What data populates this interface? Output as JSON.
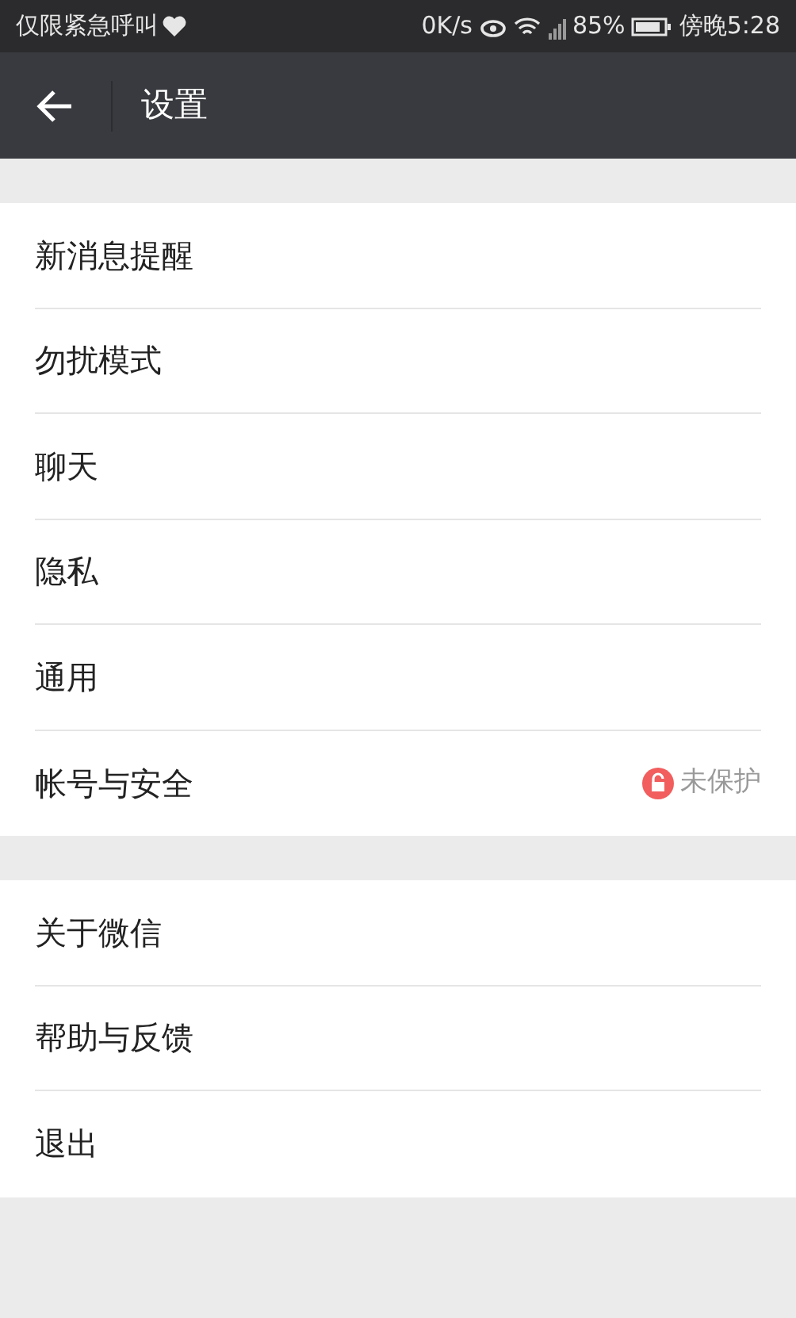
{
  "status_bar": {
    "carrier": "仅限紧急呼叫",
    "speed": "0K/s",
    "battery": "85%",
    "time": "傍晚5:28"
  },
  "header": {
    "title": "设置"
  },
  "groups": [
    {
      "items": [
        {
          "label": "新消息提醒"
        },
        {
          "label": "勿扰模式"
        },
        {
          "label": "聊天"
        },
        {
          "label": "隐私"
        },
        {
          "label": "通用"
        },
        {
          "label": "帐号与安全",
          "status": "未保护"
        }
      ]
    },
    {
      "items": [
        {
          "label": "关于微信"
        },
        {
          "label": "帮助与反馈"
        },
        {
          "label": "退出"
        }
      ]
    }
  ]
}
